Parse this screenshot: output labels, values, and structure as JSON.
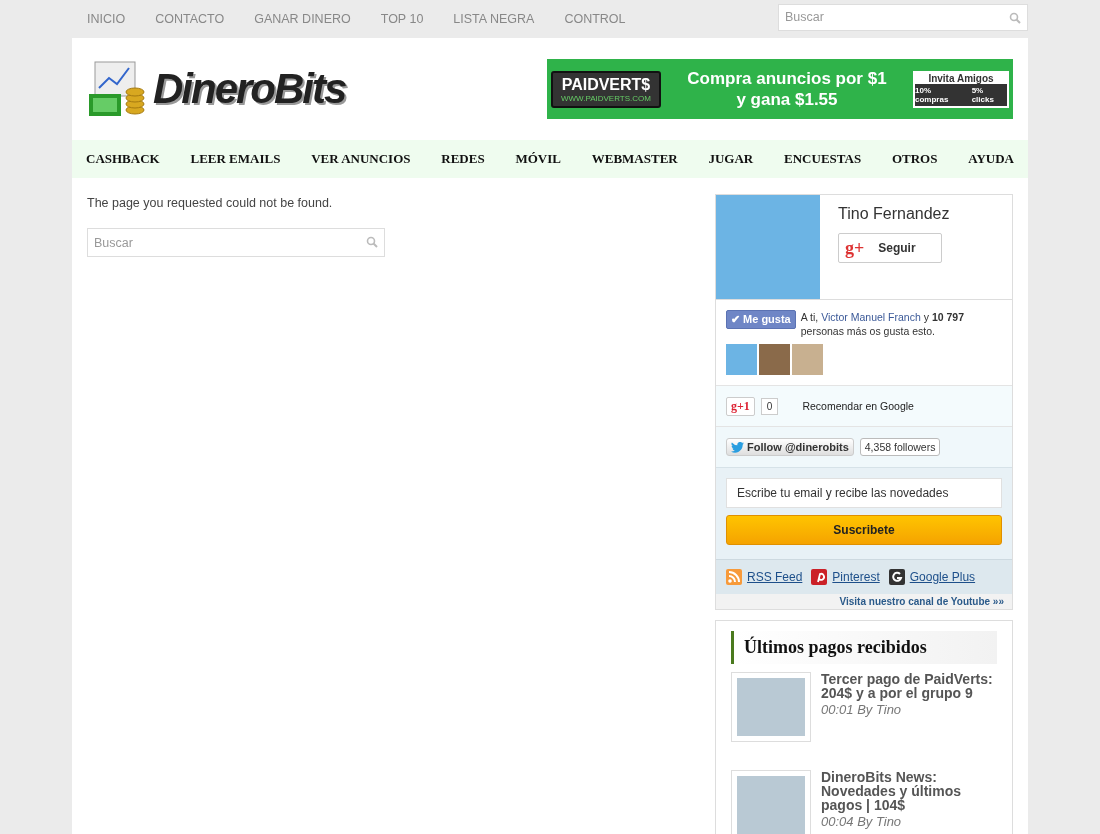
{
  "top_nav": {
    "items": [
      {
        "label": "INICIO"
      },
      {
        "label": "CONTACTO"
      },
      {
        "label": "GANAR DINERO"
      },
      {
        "label": "TOP 10"
      },
      {
        "label": "LISTA NEGRA"
      },
      {
        "label": "CONTROL"
      }
    ],
    "search": {
      "placeholder": "Buscar"
    }
  },
  "header": {
    "logo": "DineroBits",
    "ad": {
      "brand": "PAIDVERT$",
      "url": "WWW.PAIDVERTS.COM",
      "line_1": "Compra anuncios por $1",
      "line_2": "y gana $1.55",
      "invite": "Invita Amigos",
      "invite_left": "10% compras",
      "invite_right": "5% clicks"
    }
  },
  "main_nav": {
    "items": [
      {
        "label": "CASHBACK"
      },
      {
        "label": "LEER EMAILS"
      },
      {
        "label": "VER ANUNCIOS"
      },
      {
        "label": "REDES"
      },
      {
        "label": "MÓVIL"
      },
      {
        "label": "WEBMASTER"
      },
      {
        "label": "JUGAR"
      },
      {
        "label": "ENCUESTAS"
      },
      {
        "label": "OTROS"
      },
      {
        "label": "AYUDA"
      }
    ]
  },
  "content": {
    "message": "The page you requested could not be found.",
    "search": {
      "placeholder": "Buscar"
    }
  },
  "sidebar": {
    "profile": {
      "name": "Tino Fernandez",
      "icon": "g+",
      "follow": "Seguir"
    },
    "facebook": {
      "icon": "✔",
      "like": "Me gusta",
      "text_before": "A ti, ",
      "friend": "Victor Manuel Franch",
      "text_after": " y **10 797** personas más os gusta esto."
    },
    "gplus": {
      "label": "g+1",
      "count": "0",
      "text": "Recomendar en Google"
    },
    "twitter": {
      "label": "Follow @dinerobits",
      "count": "4,358 followers"
    },
    "subscribe": {
      "placeholder": "Escribe tu email y recibe las novedades",
      "button": "Suscribete"
    },
    "links": [
      {
        "kind": "rss",
        "label": "RSS Feed"
      },
      {
        "kind": "pinterest",
        "label": "Pinterest"
      },
      {
        "kind": "google",
        "label": "Google Plus"
      }
    ],
    "youtube": "Visita nuestro canal de Youtube »»",
    "payments": {
      "title": "Últimos pagos recibidos",
      "posts": [
        {
          "title": "Tercer pago de PaidVerts: 204$ y a por el grupo 9",
          "meta": "00:01 By Tino"
        },
        {
          "title": "DineroBits News: Novedades y últimos pagos | 104$",
          "meta": "00:04 By Tino"
        }
      ]
    }
  }
}
